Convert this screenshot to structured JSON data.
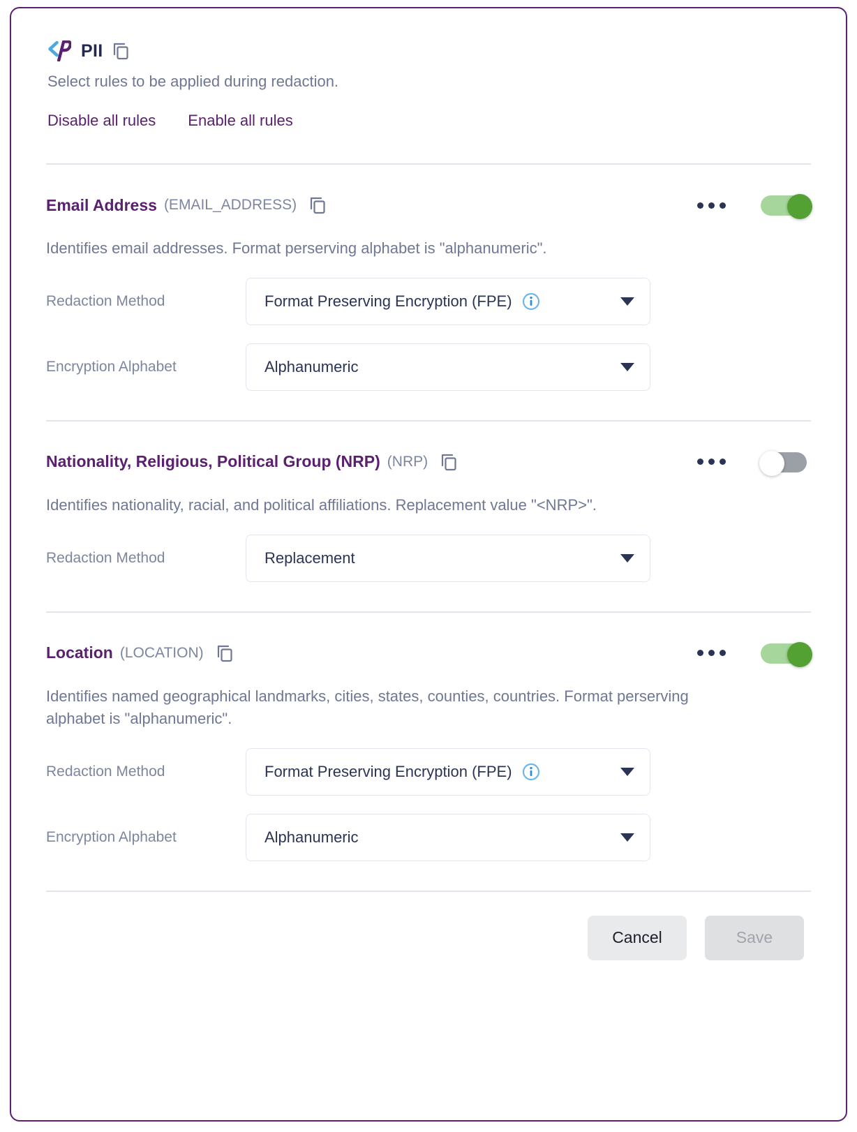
{
  "panel": {
    "accent_border": "#5b2070",
    "title": "PII",
    "logo_icon": "code-pii-icon",
    "copy_icon": "copy-icon",
    "subtitle": "Select rules to be applied during redaction.",
    "links": {
      "disable_all": "Disable all rules",
      "enable_all": "Enable all rules"
    }
  },
  "rules": [
    {
      "name": "Email Address",
      "code": "(EMAIL_ADDRESS)",
      "copy_icon": "copy-icon",
      "menu_icon": "more-options-icon",
      "enabled": true,
      "toggle_state": "on",
      "description": "Identifies email addresses. Format perserving alphabet is \"alphanumeric\".",
      "fields": [
        {
          "label": "Redaction Method",
          "value": "Format Preserving Encryption (FPE)",
          "has_info": true,
          "info_icon": "info-circle-icon"
        },
        {
          "label": "Encryption Alphabet",
          "value": "Alphanumeric",
          "has_info": false
        }
      ]
    },
    {
      "name": "Nationality, Religious, Political Group (NRP)",
      "code": "(NRP)",
      "copy_icon": "copy-icon",
      "menu_icon": "more-options-icon",
      "enabled": false,
      "toggle_state": "off",
      "description": "Identifies nationality, racial, and political affiliations. Replacement value \"<NRP>\".",
      "fields": [
        {
          "label": "Redaction Method",
          "value": "Replacement",
          "has_info": false
        }
      ]
    },
    {
      "name": "Location",
      "code": "(LOCATION)",
      "copy_icon": "copy-icon",
      "menu_icon": "more-options-icon",
      "enabled": true,
      "toggle_state": "on",
      "description": "Identifies named geographical landmarks, cities, states, counties, countries. Format perserving alphabet is \"alphanumeric\".",
      "fields": [
        {
          "label": "Redaction Method",
          "value": "Format Preserving Encryption (FPE)",
          "has_info": true,
          "info_icon": "info-circle-icon"
        },
        {
          "label": "Encryption Alphabet",
          "value": "Alphanumeric",
          "has_info": false
        }
      ]
    }
  ],
  "footer": {
    "cancel_label": "Cancel",
    "save_label": "Save",
    "save_disabled": true
  },
  "colors": {
    "accent_purple": "#5b2070",
    "toggle_on_track": "#a6d69b",
    "toggle_on_knob": "#53a033",
    "toggle_off_track": "#9aa0a6",
    "muted_text": "#6f7793",
    "value_text": "#2c3455",
    "info_blue": "#3a9ae0"
  }
}
